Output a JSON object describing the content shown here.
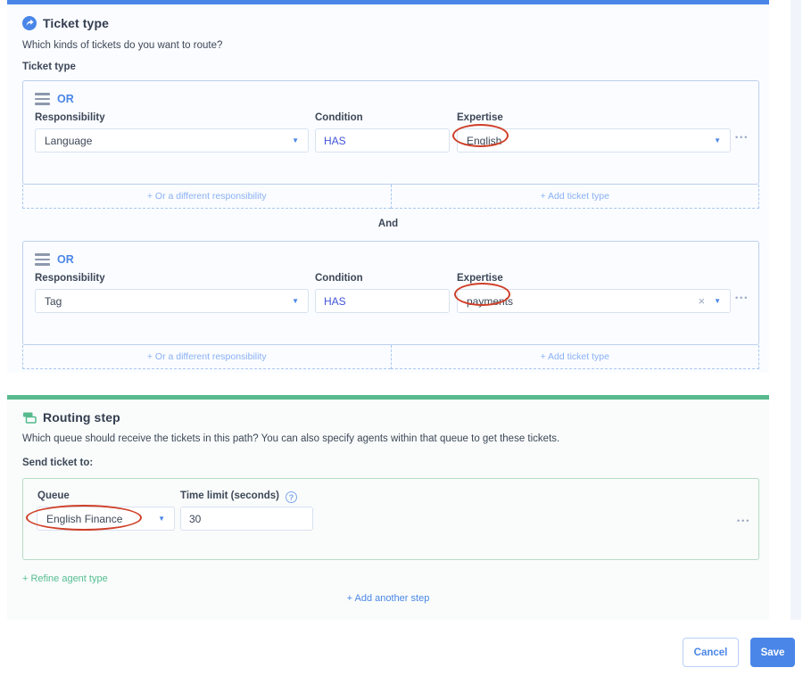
{
  "icons": {
    "caret_down": "▼",
    "dots_menu": "•••",
    "clear": "×",
    "help": "?"
  },
  "colors": {
    "accent_blue": "#4a86e8",
    "accent_green": "#57ba8d",
    "light_link_blue": "#8ab0f5",
    "condition_text_blue": "#4254d9",
    "annotation_red": "#cf3f28"
  },
  "ticket_type_card": {
    "title": "Ticket type",
    "description": "Which kinds of tickets do you want to route?",
    "section_label": "Ticket type",
    "and_label": "And",
    "groups": [
      {
        "or_label": "OR",
        "responsibility_label": "Responsibility",
        "condition_label": "Condition",
        "expertise_label": "Expertise",
        "responsibility_value": "Language",
        "condition_value": "HAS",
        "expertise_value": "English",
        "or_different_link": "+ Or a different responsibility",
        "add_ticket_type_link": "+ Add ticket type"
      },
      {
        "or_label": "OR",
        "responsibility_label": "Responsibility",
        "condition_label": "Condition",
        "expertise_label": "Expertise",
        "responsibility_value": "Tag",
        "condition_value": "HAS",
        "expertise_value": "payments",
        "or_different_link": "+ Or a different responsibility",
        "add_ticket_type_link": "+ Add ticket type"
      }
    ]
  },
  "routing_step_card": {
    "title": "Routing step",
    "description": "Which queue should receive the tickets in this path? You can also specify agents within that queue to get these tickets.",
    "section_label": "Send ticket to:",
    "queue_label": "Queue",
    "queue_value": "English Finance",
    "time_limit_label": "Time limit (seconds)",
    "time_limit_value": "30",
    "refine_agent_link": "+ Refine agent type",
    "add_another_step_link": "+ Add another step"
  },
  "footer": {
    "cancel_label": "Cancel",
    "save_label": "Save"
  }
}
